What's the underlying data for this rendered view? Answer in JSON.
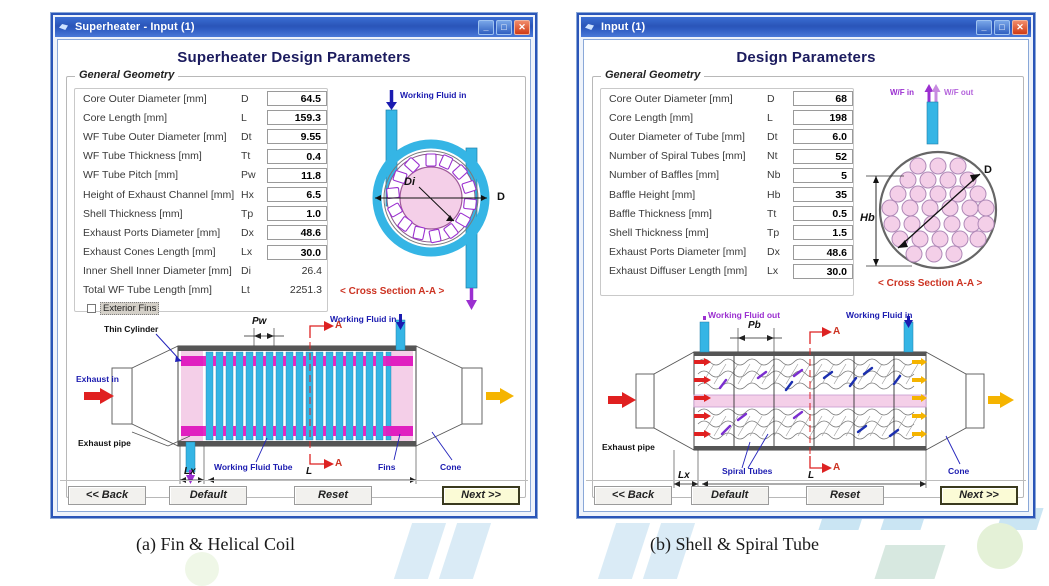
{
  "figure": {
    "captions": [
      {
        "id": "caption-a",
        "text": "(a) Fin & Helical Coil"
      },
      {
        "id": "caption-b",
        "text": "(b) Shell & Spiral Tube"
      }
    ]
  },
  "left_window": {
    "title": "Superheater - Input (1)",
    "title_icon": "app-icon",
    "window_buttons": {
      "minimize": "_",
      "maximize": "□",
      "close": "✕"
    },
    "page_title": "Superheater Design Parameters",
    "group_legend": "General Geometry",
    "params": [
      {
        "label": "Core Outer Diameter [mm]",
        "symbol": "D",
        "value": "64.5",
        "editable": true
      },
      {
        "label": "Core Length [mm]",
        "symbol": "L",
        "value": "159.3",
        "editable": true
      },
      {
        "label": "WF Tube Outer Diameter [mm]",
        "symbol": "Dt",
        "value": "9.55",
        "editable": true
      },
      {
        "label": "WF Tube Thickness [mm]",
        "symbol": "Tt",
        "value": "0.4",
        "editable": true
      },
      {
        "label": "WF Tube Pitch [mm]",
        "symbol": "Pw",
        "value": "11.8",
        "editable": true
      },
      {
        "label": "Height of Exhaust Channel [mm]",
        "symbol": "Hx",
        "value": "6.5",
        "editable": true
      },
      {
        "label": "Shell Thickness  [mm]",
        "symbol": "Tp",
        "value": "1.0",
        "editable": true
      },
      {
        "label": "Exhaust Ports Diameter [mm]",
        "symbol": "Dx",
        "value": "48.6",
        "editable": true
      },
      {
        "label": "Exhaust Cones Length [mm]",
        "symbol": "Lx",
        "value": "30.0",
        "editable": true
      },
      {
        "label": "Inner Shell Inner Diameter [mm]",
        "symbol": "Di",
        "value": "26.4",
        "editable": false
      },
      {
        "label": "Total WF Tube Length [mm]",
        "symbol": "Lt",
        "value": "2251.3",
        "editable": false
      }
    ],
    "checkbox": {
      "label": "Exterior Fins",
      "checked": false
    },
    "cross_section": {
      "inlet_label": "Working Fluid in",
      "diameter_label": "D",
      "inner_diameter_label": "Di",
      "caption": "< Cross Section A-A >"
    },
    "main_diagram": {
      "labels": {
        "thin_cylinder": "Thin Cylinder",
        "exhaust_in": "Exhaust in",
        "exhaust_pipe": "Exhaust pipe",
        "working_fluid_tube": "Working Fluid Tube",
        "working_fluid_in": "Working Fluid in",
        "fins": "Fins",
        "cone": "Cone",
        "pitch": "Pw",
        "section_mark_top": "A",
        "section_mark_bottom": "A",
        "lx": "Lx",
        "l": "L"
      }
    },
    "buttons": [
      {
        "name": "back",
        "label": "<< Back",
        "primary": false
      },
      {
        "name": "default",
        "label": "Default",
        "primary": false
      },
      {
        "name": "reset",
        "label": "Reset",
        "primary": false
      },
      {
        "name": "next",
        "label": "Next >>",
        "primary": true
      }
    ]
  },
  "right_window": {
    "title": "Input (1)",
    "title_icon": "app-icon",
    "window_buttons": {
      "minimize": "_",
      "maximize": "□",
      "close": "✕"
    },
    "page_title": "Design Parameters",
    "group_legend": "General Geometry",
    "params": [
      {
        "label": "Core Outer Diameter [mm]",
        "symbol": "D",
        "value": "68",
        "editable": true
      },
      {
        "label": "Core Length [mm]",
        "symbol": "L",
        "value": "198",
        "editable": true
      },
      {
        "label": "Outer Diameter of Tube [mm]",
        "symbol": "Dt",
        "value": "6.0",
        "editable": true
      },
      {
        "label": "Number of Spiral Tubes [mm]",
        "symbol": "Nt",
        "value": "52",
        "editable": true
      },
      {
        "label": "Number of Baffles [mm]",
        "symbol": "Nb",
        "value": "5",
        "editable": true
      },
      {
        "label": "Baffle Height [mm]",
        "symbol": "Hb",
        "value": "35",
        "editable": true
      },
      {
        "label": "Baffle Thickness [mm]",
        "symbol": "Tt",
        "value": "0.5",
        "editable": true
      },
      {
        "label": "Shell Thickness  [mm]",
        "symbol": "Tp",
        "value": "1.5",
        "editable": true
      },
      {
        "label": "Exhaust Ports Diameter [mm]",
        "symbol": "Dx",
        "value": "48.6",
        "editable": true
      },
      {
        "label": "Exhaust Diffuser Length [mm]",
        "symbol": "Lx",
        "value": "30.0",
        "editable": true
      }
    ],
    "cross_section": {
      "wf_in_label": "W/F in",
      "wf_out_label": "W/F out",
      "diameter_label": "D",
      "baffle_height_label": "Hb",
      "caption": "< Cross Section A-A >"
    },
    "main_diagram": {
      "labels": {
        "working_fluid_out": "Working Fluid out",
        "working_fluid_in": "Working Fluid in",
        "exhaust_pipe": "Exhaust pipe",
        "spiral_tubes": "Spiral Tubes",
        "cone": "Cone",
        "baffle_pitch": "Pb",
        "section_mark_top": "A",
        "section_mark_bottom": "A",
        "lx": "Lx",
        "l": "L"
      }
    },
    "buttons": [
      {
        "name": "back",
        "label": "<< Back",
        "primary": false
      },
      {
        "name": "default",
        "label": "Default",
        "primary": false
      },
      {
        "name": "reset",
        "label": "Reset",
        "primary": false
      },
      {
        "name": "next",
        "label": "Next >>",
        "primary": true
      }
    ]
  },
  "colors": {
    "titlebar": "#2a55b8",
    "accent_cyan": "#35b5e5",
    "accent_pink": "#f4cfe8",
    "accent_magenta": "#e020c0",
    "exhaust_red": "#e02020",
    "outlet_orange": "#f5b400",
    "purple": "#9b2fd0",
    "heading": "#1b1b5e"
  }
}
